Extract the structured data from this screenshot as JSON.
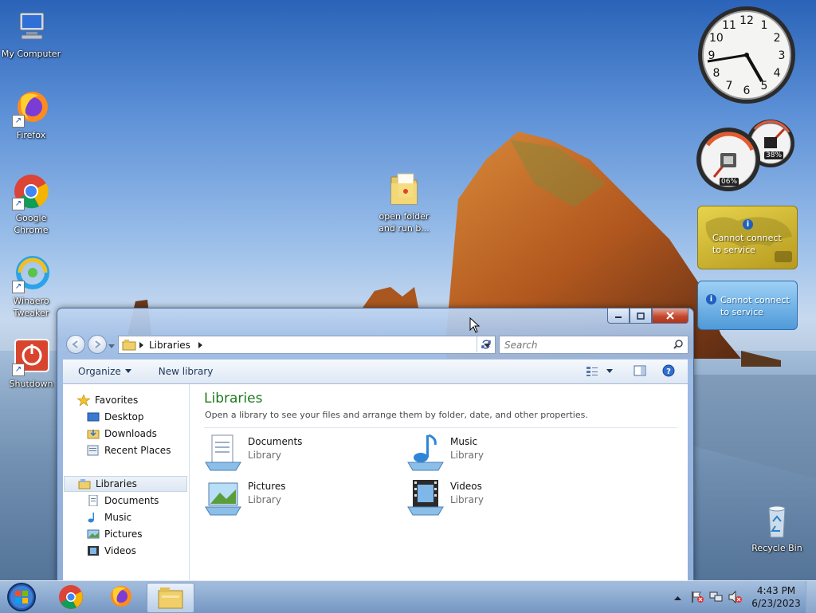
{
  "desktop": {
    "icons": [
      {
        "label": "My Computer"
      },
      {
        "label": "Firefox"
      },
      {
        "label": "Google Chrome"
      },
      {
        "label": "Winaero Tweaker"
      },
      {
        "label": "Shutdown"
      },
      {
        "label": "open folder and run b..."
      },
      {
        "label": "Recycle Bin"
      }
    ]
  },
  "gadgets": {
    "clock": {
      "numerals": [
        "12",
        "1",
        "2",
        "3",
        "4",
        "5",
        "6",
        "7",
        "8",
        "9",
        "10",
        "11"
      ]
    },
    "meter": {
      "cpu": "06%",
      "memory": "38%"
    },
    "weather": {
      "message": "Cannot connect to service"
    },
    "currency": {
      "message": "Cannot connect to service"
    }
  },
  "explorer": {
    "address": {
      "crumb": "Libraries"
    },
    "search": {
      "placeholder": "Search"
    },
    "toolbar": {
      "organize": "Organize",
      "new_library": "New library"
    },
    "nav": {
      "favorites": "Favorites",
      "favorites_items": [
        "Desktop",
        "Downloads",
        "Recent Places"
      ],
      "libraries": "Libraries",
      "libraries_items": [
        "Documents",
        "Music",
        "Pictures",
        "Videos"
      ]
    },
    "content": {
      "title": "Libraries",
      "description": "Open a library to see your files and arrange them by folder, date, and other properties.",
      "libraries": [
        {
          "name": "Documents",
          "type": "Library"
        },
        {
          "name": "Music",
          "type": "Library"
        },
        {
          "name": "Pictures",
          "type": "Library"
        },
        {
          "name": "Videos",
          "type": "Library"
        }
      ]
    }
  },
  "taskbar": {
    "time": "4:43 PM",
    "date": "6/23/2023"
  },
  "colors": {
    "content_title": "#1e7a1e",
    "close_button": "#c24a2f",
    "weather_bg": "#c9b22a",
    "currency_bg": "#4f9ad8"
  }
}
